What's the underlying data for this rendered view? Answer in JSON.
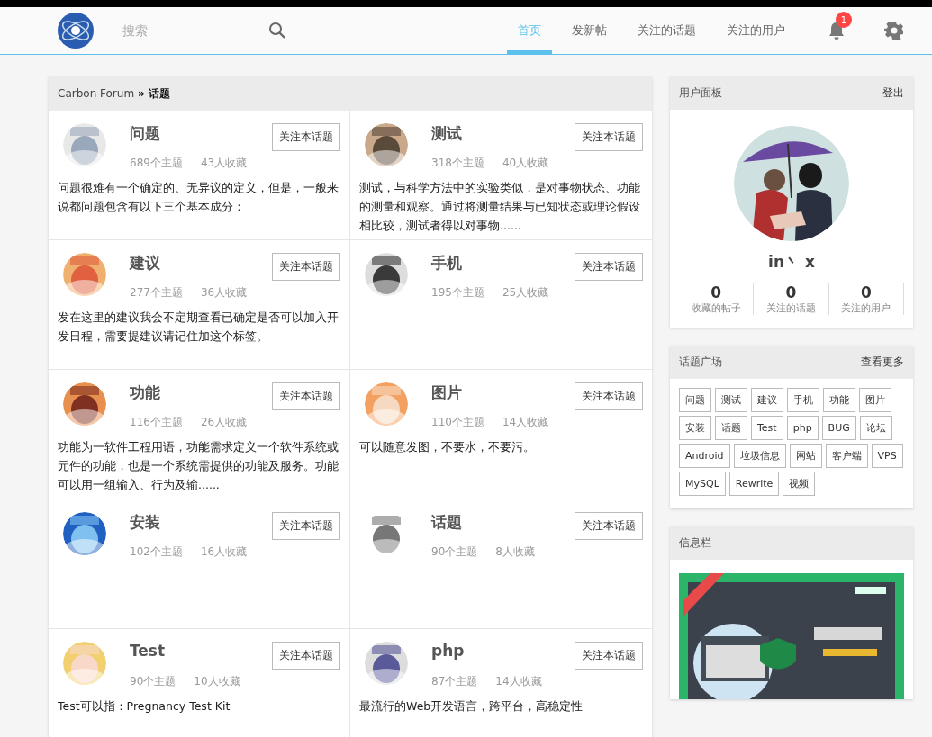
{
  "header": {
    "search": {
      "placeholder": "搜索"
    },
    "nav": [
      {
        "label": "首页",
        "selected": true
      },
      {
        "label": "发新帖",
        "selected": false
      },
      {
        "label": "关注的话题",
        "selected": false
      },
      {
        "label": "关注的用户",
        "selected": false
      }
    ],
    "notifications": {
      "count": "1"
    }
  },
  "breadcrumb": {
    "root": "Carbon Forum",
    "separator": "»",
    "current": "话题"
  },
  "topics": [
    {
      "title": "问题",
      "follow": "关注本话题",
      "threads": "689个主题",
      "favorites": "43人收藏",
      "description": "问题很难有一个确定的、无异议的定义，但是，一般来说都问题包含有以下三个基本成分："
    },
    {
      "title": "测试",
      "follow": "关注本话题",
      "threads": "318个主题",
      "favorites": "40人收藏",
      "description": "测试，与科学方法中的实验类似，是对事物状态、功能的测量和观察。通过将测量结果与已知状态或理论假设相比较，测试者得以对事物......"
    },
    {
      "title": "建议",
      "follow": "关注本话题",
      "threads": "277个主题",
      "favorites": "36人收藏",
      "description": "发在这里的建议我会不定期查看已确定是否可以加入开发日程，需要提建议请记住加这个标签。"
    },
    {
      "title": "手机",
      "follow": "关注本话题",
      "threads": "195个主题",
      "favorites": "25人收藏"
    },
    {
      "title": "功能",
      "follow": "关注本话题",
      "threads": "116个主题",
      "favorites": "26人收藏",
      "description": "功能为一软件工程用语，功能需求定义一个软件系统或元件的功能，也是一个系统需提供的功能及服务。功能可以用一组输入、行为及输......"
    },
    {
      "title": "图片",
      "follow": "关注本话题",
      "threads": "110个主题",
      "favorites": "14人收藏",
      "description": "可以随意发图，不要水，不要污。"
    },
    {
      "title": "安装",
      "follow": "关注本话题",
      "threads": "102个主题",
      "favorites": "16人收藏"
    },
    {
      "title": "话题",
      "follow": "关注本话题",
      "threads": "90个主题",
      "favorites": "8人收藏"
    },
    {
      "title": "Test",
      "follow": "关注本话题",
      "threads": "90个主题",
      "favorites": "10人收藏",
      "description": "Test可以指：Pregnancy Test Kit"
    },
    {
      "title": "php",
      "follow": "关注本话题",
      "threads": "87个主题",
      "favorites": "14人收藏",
      "description": "最流行的Web开发语言，跨平台，高稳定性"
    }
  ],
  "user_panel": {
    "title": "用户面板",
    "logout": "登出",
    "username": "in丶 x",
    "stats": [
      {
        "value": "0",
        "label": "收藏的帖子"
      },
      {
        "value": "0",
        "label": "关注的话题"
      },
      {
        "value": "0",
        "label": "关注的用户"
      }
    ]
  },
  "tag_panel": {
    "title": "话题广场",
    "more": "查看更多",
    "tags": [
      "问题",
      "测试",
      "建议",
      "手机",
      "功能",
      "图片",
      "安装",
      "话题",
      "Test",
      "php",
      "BUG",
      "论坛",
      "Android",
      "垃圾信息",
      "网站",
      "客户端",
      "VPS",
      "MySQL",
      "Rewrite",
      "视频"
    ]
  },
  "info_panel": {
    "title": "信息栏"
  }
}
